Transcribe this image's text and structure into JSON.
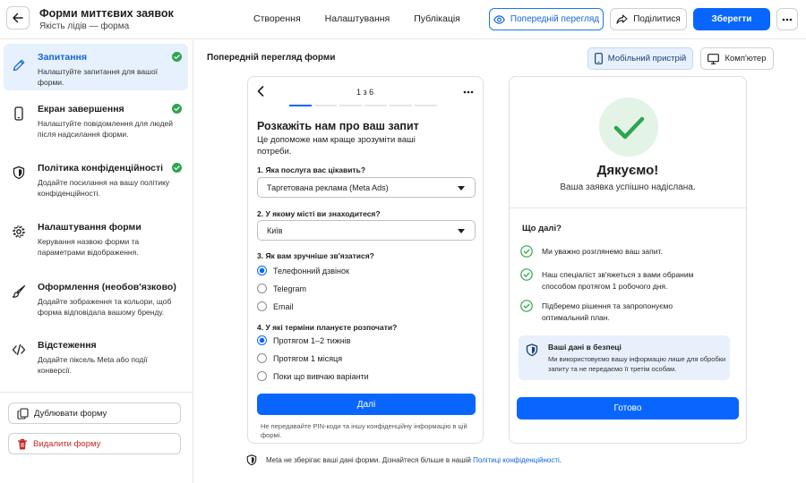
{
  "header": {
    "title": "Форми миттєвих заявок",
    "subtitle": "Якість лідів — форма",
    "tabs": [
      "Створення",
      "Налаштування",
      "Публікація"
    ],
    "preview_label": "Попередній перегляд",
    "share_label": "Поділитися",
    "save_label": "Зберегти"
  },
  "sidebar": {
    "items": [
      {
        "title": "Запитання",
        "desc": "Налаштуйте запитання для вашої форми.",
        "icon": "pencil-icon",
        "done": true
      },
      {
        "title": "Екран завершення",
        "desc": "Налаштуйте повідомлення для людей після надсилання форми.",
        "icon": "phone-icon",
        "done": true
      },
      {
        "title": "Політика конфіденційності",
        "desc": "Додайте посилання на вашу політику конфіденційності.",
        "icon": "shield-icon",
        "done": true
      },
      {
        "title": "Налаштування форми",
        "desc": "Керування назвою форми та параметрами відображення.",
        "icon": "gear-icon",
        "done": false
      },
      {
        "title": "Оформлення (необов'язково)",
        "desc": "Додайте зображення та кольори, щоб форма відповідала вашому бренду.",
        "icon": "brush-icon",
        "done": false
      },
      {
        "title": "Відстеження",
        "desc": "Додайте піксель Meta або події конверсії.",
        "icon": "code-icon",
        "done": false
      }
    ],
    "duplicate_label": "Дублювати форму",
    "delete_label": "Видалити форму"
  },
  "preview": {
    "title": "Попередній перегляд форми",
    "mobile_label": "Мобільний пристрій",
    "desktop_label": "Комп'ютер"
  },
  "form": {
    "step": "1 з 6",
    "progress": {
      "current": 1,
      "total": 6
    },
    "heading": "Розкажіть нам про ваш запит",
    "intro": "Це допоможе нам краще зрозуміти ваші потреби.",
    "q1": {
      "label": "1. Яка послуга вас цікавить?",
      "value": "Таргетована реклама (Meta Ads)"
    },
    "q2": {
      "label": "2. У якому місті ви знаходитеся?",
      "value": "Київ"
    },
    "q3": {
      "label": "3. Як вам зручніше зв'язатися?",
      "options": [
        "Телефонний дзвінок",
        "Telegram",
        "Email"
      ],
      "selected": 0
    },
    "q4": {
      "label": "4. У які терміни плануєте розпочати?",
      "options": [
        "Протягом 1–2 тижнів",
        "Протягом 1 місяця",
        "Поки що вивчаю варіанти"
      ],
      "selected": 0
    },
    "next_label": "Далі",
    "footnote": "Не передавайте PIN-коди та іншу конфіденційну інформацію в цій формі."
  },
  "thanks": {
    "title": "Дякуємо!",
    "subtitle": "Ваша заявка успішно надіслана.",
    "next_title": "Що далі?",
    "steps": [
      "Ми уважно розглянемо ваш запит.",
      "Наш спеціаліст зв'яжеться з вами обраним способом протягом 1 робочого дня.",
      "Підберемо рішення та запропонуємо оптимальний план."
    ],
    "secure_title": "Ваші дані в безпеці",
    "secure_text": "Ми використовуємо вашу інформацію лише для обробки запиту та не передаємо її третім особам.",
    "done_label": "Готово"
  },
  "footer": {
    "note": "Meta не зберігає ваші дані форми. Дізнайтеся більше в нашій",
    "link": "Політиці конфіденційності",
    "end": "."
  },
  "colors": {
    "accent": "#0866ff",
    "success": "#2ea44f",
    "danger": "#c62828"
  }
}
